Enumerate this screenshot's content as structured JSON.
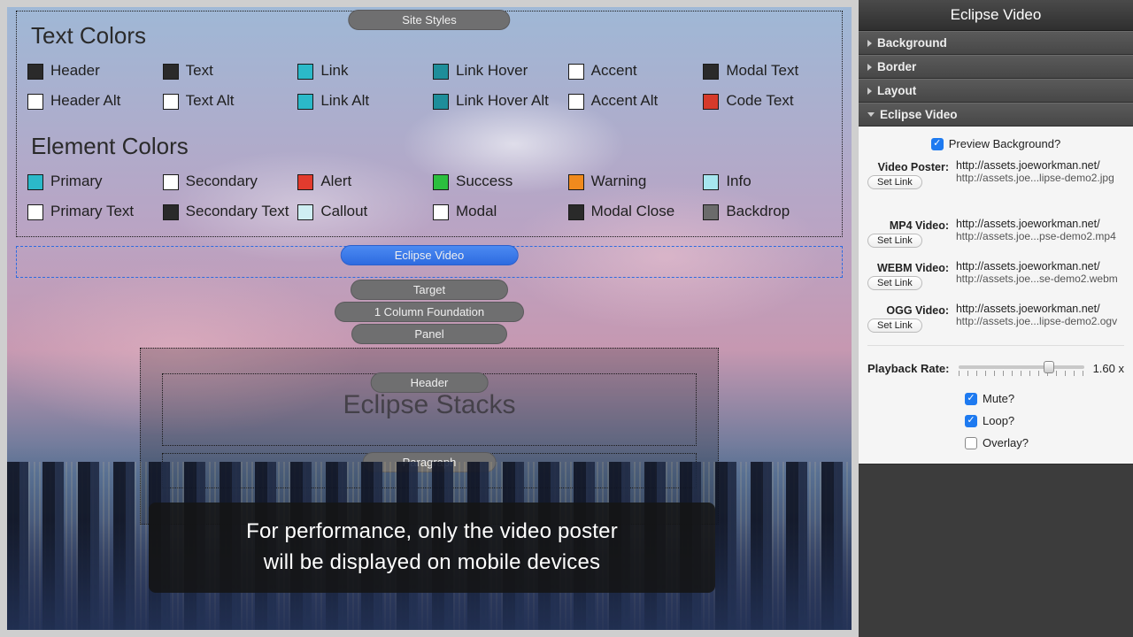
{
  "canvas": {
    "site_styles_tab": "Site Styles",
    "text_colors": {
      "title": "Text Colors",
      "items": [
        {
          "label": "Header",
          "color": "#2a2a2a"
        },
        {
          "label": "Text",
          "color": "#2a2a2a"
        },
        {
          "label": "Link",
          "color": "#2bb9c9"
        },
        {
          "label": "Link Hover",
          "color": "#1e8e9a"
        },
        {
          "label": "Accent",
          "color": "#ffffff"
        },
        {
          "label": "Modal Text",
          "color": "#2a2a2a"
        },
        {
          "label": "Header Alt",
          "color": "#ffffff"
        },
        {
          "label": "Text Alt",
          "color": "#ffffff"
        },
        {
          "label": "Link Alt",
          "color": "#2bb9c9"
        },
        {
          "label": "Link Hover Alt",
          "color": "#1e8e9a"
        },
        {
          "label": "Accent Alt",
          "color": "#ffffff"
        },
        {
          "label": "Code Text",
          "color": "#d63a2a"
        }
      ]
    },
    "element_colors": {
      "title": "Element Colors",
      "items": [
        {
          "label": "Primary",
          "color": "#2bb9c9"
        },
        {
          "label": "Secondary",
          "color": "#ffffff"
        },
        {
          "label": "Alert",
          "color": "#e23b2e"
        },
        {
          "label": "Success",
          "color": "#2bbf3e"
        },
        {
          "label": "Warning",
          "color": "#f08a1d"
        },
        {
          "label": "Info",
          "color": "#a7e6ef"
        },
        {
          "label": "Primary Text",
          "color": "#ffffff"
        },
        {
          "label": "Secondary Text",
          "color": "#2a2a2a"
        },
        {
          "label": "Callout",
          "color": "#cfeef3"
        },
        {
          "label": "Modal",
          "color": "#ffffff"
        },
        {
          "label": "Modal Close",
          "color": "#2a2a2a"
        },
        {
          "label": "Backdrop",
          "color": "#6b6b6b"
        }
      ]
    },
    "tabs": {
      "eclipse_video": "Eclipse Video",
      "target": "Target",
      "one_col": "1 Column Foundation",
      "panel": "Panel",
      "header": "Header",
      "header_title": "Eclipse Stacks",
      "paragraph": "Paragraph"
    },
    "caption_line1": "For performance, only the video poster",
    "caption_line2": "will be displayed on mobile devices"
  },
  "inspector": {
    "title": "Eclipse Video",
    "sections": {
      "background": "Background",
      "border": "Border",
      "layout": "Layout",
      "eclipse_video": "Eclipse Video"
    },
    "preview_bg_label": "Preview Background?",
    "video_poster": {
      "label": "Video Poster:",
      "url1": "http://assets.joeworkman.net/",
      "url2": "http://assets.joe...lipse-demo2.jpg",
      "set": "Set Link"
    },
    "mp4": {
      "label": "MP4 Video:",
      "url1": "http://assets.joeworkman.net/",
      "url2": "http://assets.joe...pse-demo2.mp4",
      "set": "Set Link"
    },
    "webm": {
      "label": "WEBM Video:",
      "url1": "http://assets.joeworkman.net/",
      "url2": "http://assets.joe...se-demo2.webm",
      "set": "Set Link"
    },
    "ogg": {
      "label": "OGG Video:",
      "url1": "http://assets.joeworkman.net/",
      "url2": "http://assets.joe...lipse-demo2.ogv",
      "set": "Set Link"
    },
    "rate_label": "Playback Rate:",
    "rate_value": "1.60 x",
    "rate_percent": 72,
    "mute_label": "Mute?",
    "loop_label": "Loop?",
    "overlay_label": "Overlay?"
  }
}
